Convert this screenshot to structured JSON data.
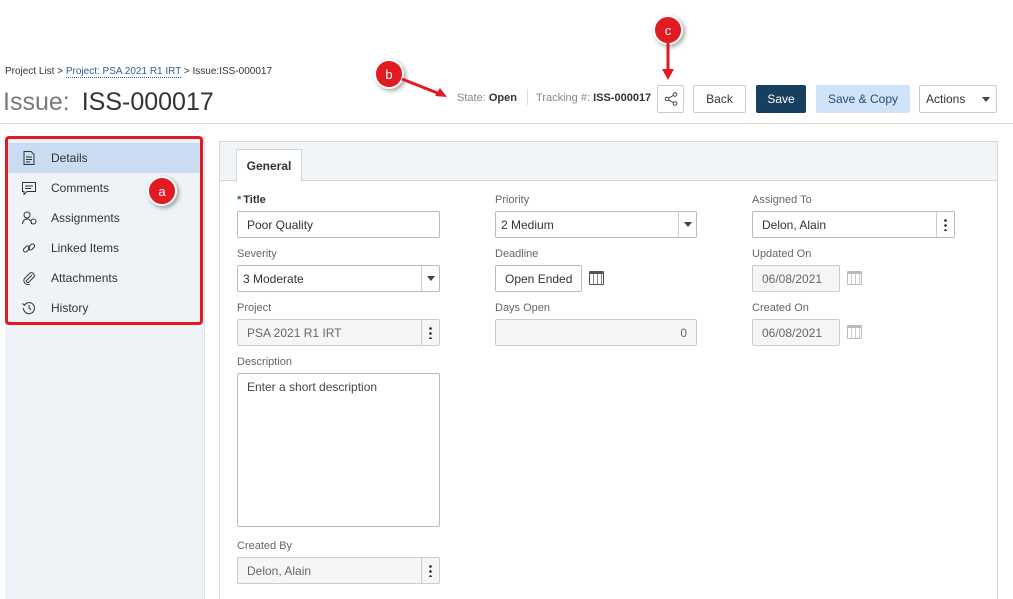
{
  "breadcrumb": {
    "root": "Project List",
    "sep": " > ",
    "project": "Project: PSA 2021 R1 IRT",
    "current": "Issue:ISS-000017"
  },
  "page": {
    "title_prefix": "Issue:",
    "title_value": "ISS-000017"
  },
  "meta": {
    "state_label": "State:",
    "state_value": "Open",
    "tracking_label": "Tracking #:",
    "tracking_value": "ISS-000017"
  },
  "toolbar": {
    "share_icon": "share-icon",
    "back_label": "Back",
    "save_label": "Save",
    "save_copy_label": "Save & Copy",
    "actions_label": "Actions"
  },
  "sidebar": {
    "items": [
      {
        "label": "Details",
        "icon": "document-icon",
        "active": true
      },
      {
        "label": "Comments",
        "icon": "comment-icon"
      },
      {
        "label": "Assignments",
        "icon": "user-assign-icon"
      },
      {
        "label": "Linked Items",
        "icon": "link-icon"
      },
      {
        "label": "Attachments",
        "icon": "paperclip-icon"
      },
      {
        "label": "History",
        "icon": "history-icon"
      }
    ]
  },
  "callouts": {
    "a": "a",
    "b": "b",
    "c": "c"
  },
  "tabs": {
    "general": "General"
  },
  "form": {
    "title_label": "Title",
    "title_value": "Poor Quality",
    "severity_label": "Severity",
    "severity_value": "3 Moderate",
    "project_label": "Project",
    "project_value": "PSA 2021 R1 IRT",
    "description_label": "Description",
    "description_placeholder": "Enter a short description",
    "created_by_label": "Created By",
    "created_by_value": "Delon, Alain",
    "priority_label": "Priority",
    "priority_value": "2 Medium",
    "deadline_label": "Deadline",
    "deadline_value": "Open Ended",
    "days_open_label": "Days Open",
    "days_open_value": "0",
    "assigned_to_label": "Assigned To",
    "assigned_to_value": "Delon, Alain",
    "updated_on_label": "Updated On",
    "updated_on_value": "06/08/2021",
    "created_on_label": "Created On",
    "created_on_value": "06/08/2021"
  },
  "colors": {
    "accent": "#173f5f",
    "callout": "#e01b22",
    "secondary": "#cfe2f7"
  }
}
